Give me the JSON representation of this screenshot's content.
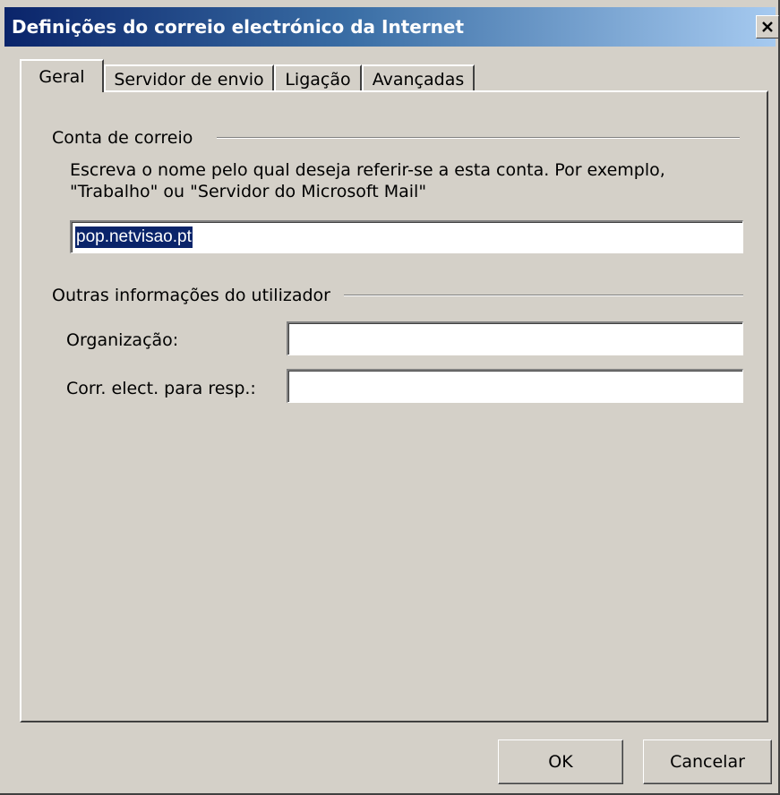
{
  "window": {
    "title": "Definições do correio electrónico da Internet",
    "close_glyph": "✕"
  },
  "tabs": [
    {
      "label": "Geral",
      "active": true
    },
    {
      "label": "Servidor de envio",
      "active": false
    },
    {
      "label": "Ligação",
      "active": false
    },
    {
      "label": "Avançadas",
      "active": false
    }
  ],
  "account_section": {
    "heading": "Conta de correio",
    "description_line1": "Escreva o nome pelo qual deseja referir-se a esta conta. Por exemplo,",
    "description_line2": "\"Trabalho\" ou \"Servidor do Microsoft Mail\"",
    "account_name_value": "pop.netvisao.pt"
  },
  "user_section": {
    "heading": "Outras informações do utilizador",
    "organization_label": "Organização:",
    "organization_value": "",
    "reply_email_label": "Corr. elect. para resp.:",
    "reply_email_value": ""
  },
  "buttons": {
    "ok_label": "OK",
    "cancel_label": "Cancelar"
  },
  "colors": {
    "dialog_face": "#d4d0c8",
    "title_active_start": "#0a246a",
    "title_active_end": "#a6caf0",
    "selection": "#0a246a"
  }
}
